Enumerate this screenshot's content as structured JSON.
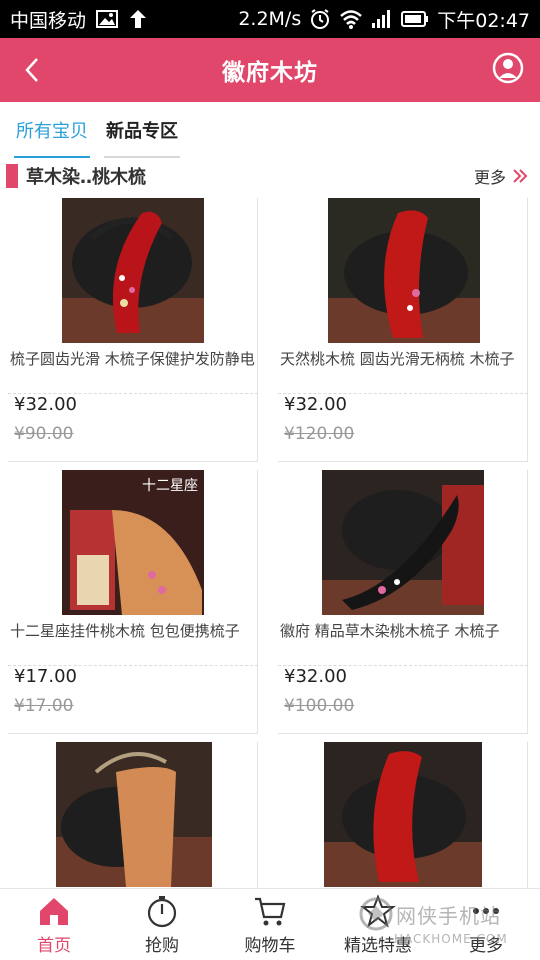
{
  "status_bar": {
    "carrier": "中国移动",
    "speed": "2.2M/s",
    "time": "下午02:47"
  },
  "header": {
    "title": "徽府木坊",
    "bg_color": "#e0476a"
  },
  "tabs": [
    {
      "label": "所有宝贝",
      "active": true
    },
    {
      "label": "新品专区",
      "active": false
    }
  ],
  "section": {
    "title": "草木染‥桃木梳",
    "more_label": "更多"
  },
  "products": [
    {
      "name": "梳子圆齿光滑 木梳子保健护发防静电",
      "price": "¥32.00",
      "old_price": "¥90.00"
    },
    {
      "name": "天然桃木梳 圆齿光滑无柄梳 木梳子",
      "price": "¥32.00",
      "old_price": "¥120.00"
    },
    {
      "name": "十二星座挂件桃木梳 包包便携梳子",
      "price": "¥17.00",
      "old_price": "¥17.00"
    },
    {
      "name": "徽府 精品草木染桃木梳子 木梳子",
      "price": "¥32.00",
      "old_price": "¥100.00"
    },
    {
      "name": "",
      "price": "",
      "old_price": ""
    },
    {
      "name": "",
      "price": "",
      "old_price": ""
    }
  ],
  "product_image_label": "十二星座",
  "bottom_nav": [
    {
      "label": "首页",
      "icon": "home-icon",
      "active": true
    },
    {
      "label": "抢购",
      "icon": "stopwatch-icon",
      "active": false
    },
    {
      "label": "购物车",
      "icon": "cart-icon",
      "active": false
    },
    {
      "label": "精选特惠",
      "icon": "star-icon",
      "active": false
    },
    {
      "label": "更多",
      "icon": "more-icon",
      "active": false
    }
  ],
  "watermark": {
    "text": "网侠手机站",
    "sub": "HACKHOME.COM"
  }
}
